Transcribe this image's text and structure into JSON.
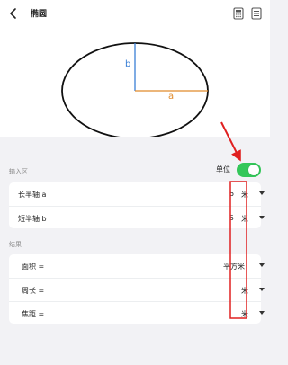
{
  "header": {
    "title": "椭圆"
  },
  "diagram": {
    "label_a": "a",
    "label_b": "b"
  },
  "input_section": {
    "label": "输入区",
    "unit_toggle_label": "单位",
    "unit_toggle_on": true,
    "rows": [
      {
        "label": "长半轴 a",
        "value": "6",
        "unit": "米"
      },
      {
        "label": "短半轴 b",
        "value": "5",
        "unit": "米"
      }
    ]
  },
  "result_section": {
    "label": "结果",
    "rows": [
      {
        "label": "面积 =",
        "value": "",
        "unit": "平方米"
      },
      {
        "label": "周长 =",
        "value": "",
        "unit": "米"
      },
      {
        "label": "焦距 =",
        "value": "",
        "unit": "米"
      }
    ]
  },
  "colors": {
    "accent": "#34c759",
    "highlight": "#e02020",
    "axis_a": "#e08a2a",
    "axis_b": "#3a7fd5"
  }
}
